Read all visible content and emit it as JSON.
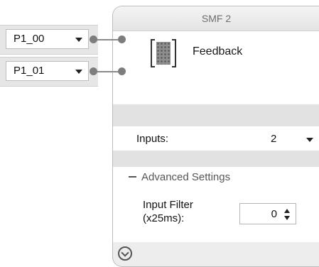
{
  "inputs": [
    {
      "name": "P1_00"
    },
    {
      "name": "P1_01"
    }
  ],
  "block": {
    "title": "SMF 2",
    "icon": "relay-chip-icon",
    "label": "Feedback"
  },
  "settings": {
    "inputs_label": "Inputs:",
    "inputs_value": "2",
    "advanced_label": "Advanced Settings",
    "filter_label_line1": "Input Filter",
    "filter_label_line2": "(x25ms):",
    "filter_value": "0"
  },
  "colors": {
    "panel_bg": "#ededed",
    "wire": "#8a8a8a"
  }
}
